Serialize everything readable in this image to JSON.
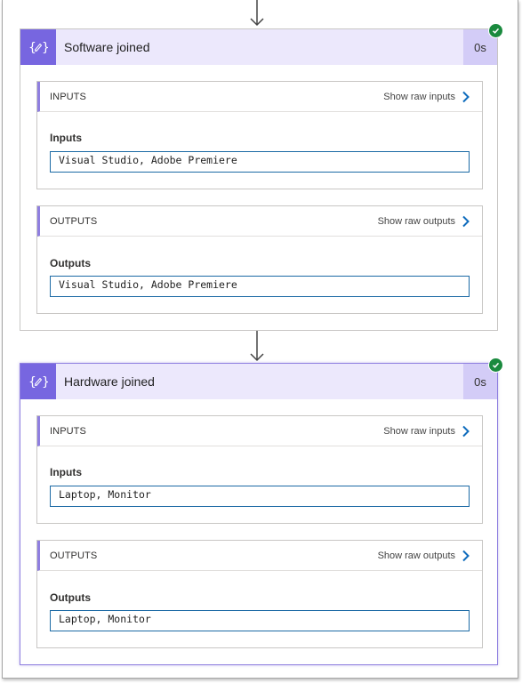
{
  "actions": [
    {
      "title": "Software joined",
      "duration": "0s",
      "status_icon": "check-circle-icon",
      "inputs": {
        "section_label": "INPUTS",
        "raw_link": "Show raw inputs",
        "field_label": "Inputs",
        "value": "Visual Studio, Adobe Premiere"
      },
      "outputs": {
        "section_label": "OUTPUTS",
        "raw_link": "Show raw outputs",
        "field_label": "Outputs",
        "value": "Visual Studio, Adobe Premiere"
      }
    },
    {
      "title": "Hardware joined",
      "duration": "0s",
      "status_icon": "check-circle-icon",
      "inputs": {
        "section_label": "INPUTS",
        "raw_link": "Show raw inputs",
        "field_label": "Inputs",
        "value": "Laptop, Monitor"
      },
      "outputs": {
        "section_label": "OUTPUTS",
        "raw_link": "Show raw outputs",
        "field_label": "Outputs",
        "value": "Laptop, Monitor"
      }
    }
  ],
  "colors": {
    "icon_bg": "#7766e0",
    "header_bg": "#ece8fc",
    "duration_bg": "#d3ccf7",
    "accent": "#8f7fe0",
    "link_chevron": "#0f6cbd",
    "success": "#1a8a3e",
    "field_border": "#1c6aa5"
  }
}
